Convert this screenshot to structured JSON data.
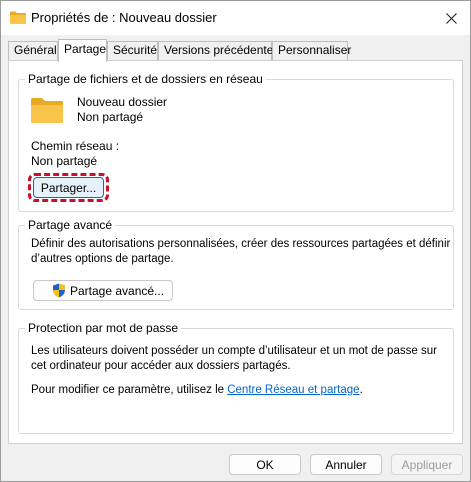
{
  "window": {
    "title": "Propriétés de : Nouveau dossier"
  },
  "tabs": [
    {
      "label": "Général"
    },
    {
      "label": "Partage"
    },
    {
      "label": "Sécurité"
    },
    {
      "label": "Versions précédentes"
    },
    {
      "label": "Personnaliser"
    }
  ],
  "network_sharing": {
    "group_title": "Partage de fichiers et de dossiers en réseau",
    "folder_name": "Nouveau dossier",
    "folder_status": "Non partagé",
    "network_path_label": "Chemin réseau :",
    "network_path_value": "Non partagé",
    "share_button": "Partager..."
  },
  "advanced_sharing": {
    "group_title": "Partage avancé",
    "description_line1": "Définir des autorisations personnalisées, créer des ressources partagées et définir",
    "description_line2": "d’autres options de partage.",
    "button": "Partage avancé..."
  },
  "password_protection": {
    "group_title": "Protection par mot de passe",
    "description_line1": "Les utilisateurs doivent posséder un compte d’utilisateur et un mot de passe sur",
    "description_line2": "cet ordinateur pour accéder aux dossiers partagés.",
    "change_text": "Pour modifier ce paramètre, utilisez le ",
    "link_text": "Centre Réseau et partage",
    "period": "."
  },
  "footer": {
    "ok": "OK",
    "cancel": "Annuler",
    "apply": "Appliquer"
  },
  "colors": {
    "accent": "#0f6cbd",
    "highlight": "#c8102e",
    "folder": "#f8c44a",
    "link": "#0066cc"
  }
}
